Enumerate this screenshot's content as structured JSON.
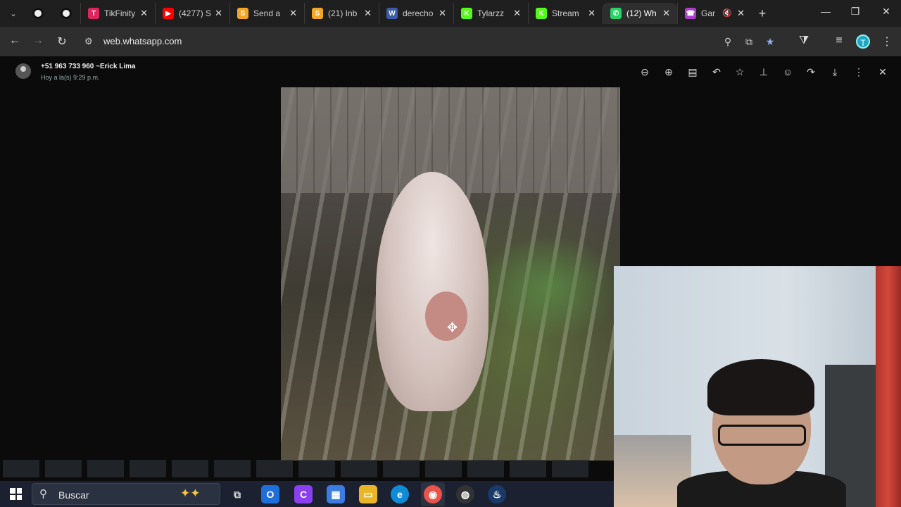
{
  "browser": {
    "tabs": [
      {
        "title": "TikFinity",
        "color": "#e0245e",
        "glyph": "T"
      },
      {
        "title": "(4277) S",
        "color": "#ff0000",
        "glyph": "▶"
      },
      {
        "title": "Send a",
        "color": "#f5a623",
        "glyph": "S"
      },
      {
        "title": "(21) Inb",
        "color": "#f5a623",
        "glyph": "S"
      },
      {
        "title": "derecho",
        "color": "#3c5ba9",
        "glyph": "W"
      },
      {
        "title": "Tylarzz",
        "color": "#53fc18",
        "glyph": "K"
      },
      {
        "title": "Stream",
        "color": "#53fc18",
        "glyph": "K"
      },
      {
        "title": "(12) Wh",
        "color": "#25d366",
        "glyph": "✆"
      },
      {
        "title": "Gar",
        "color": "#b03cce",
        "glyph": "☎"
      }
    ],
    "url": "web.whatsapp.com",
    "profile_initial": "T"
  },
  "viewer": {
    "sender_name": "+51 963 733 960 ~Erick Lima",
    "sender_time": "Hoy a la(s) 9:29 p.m.",
    "toolbar_icons": [
      "zoom-out-icon",
      "zoom-in-icon",
      "go-to-message-icon",
      "reply-icon",
      "star-icon",
      "pin-icon",
      "react-icon",
      "forward-icon",
      "download-icon",
      "menu-icon",
      "close-icon"
    ]
  },
  "taskbar": {
    "search_placeholder": "Buscar"
  }
}
